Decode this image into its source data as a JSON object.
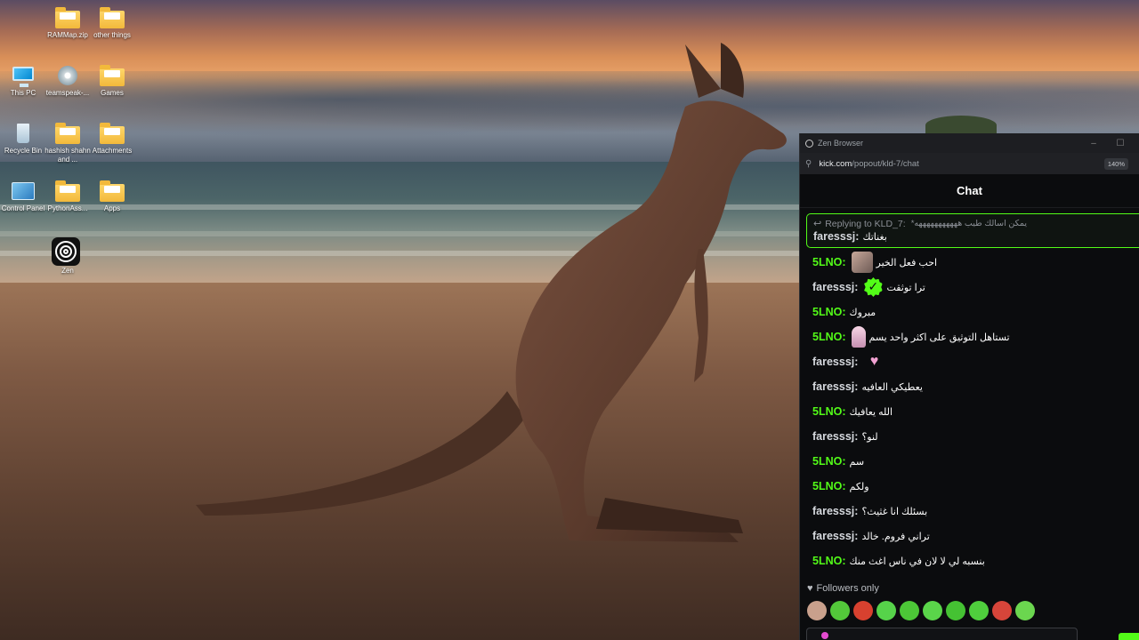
{
  "desktop": {
    "icons": [
      {
        "label": "RAMMap.zip",
        "icon": "zip-folder-icon"
      },
      {
        "label": "other things",
        "icon": "folder-icon"
      },
      {
        "label": "This PC",
        "icon": "monitor-icon"
      },
      {
        "label": "teamspeak-...",
        "icon": "disc-installer-icon"
      },
      {
        "label": "Games",
        "icon": "folder-icon"
      },
      {
        "label": "Recycle Bin",
        "icon": "recycle-bin-icon"
      },
      {
        "label": "hashish shahn and ...",
        "icon": "folder-icon"
      },
      {
        "label": "Attachments",
        "icon": "folder-icon"
      },
      {
        "label": "Control Panel",
        "icon": "control-panel-icon"
      },
      {
        "label": "PythonAss...",
        "icon": "folder-icon"
      },
      {
        "label": "Apps",
        "icon": "folder-icon"
      },
      {
        "label": "Zen",
        "icon": "zen-browser-icon"
      }
    ]
  },
  "browser": {
    "title": "Zen Browser",
    "url_domain": "kick.com",
    "url_path": "/popout/kld-7/chat",
    "zoom": "140%",
    "controls": {
      "minimize": "–",
      "maximize": "☐"
    }
  },
  "chat": {
    "header": "Chat",
    "reply": {
      "prefix": "Replying to KLD_7:",
      "quoted": "يمكن اسالك طيب هههههههههههه*",
      "user": "faresssj:",
      "text": "بغناتك"
    },
    "messages": [
      {
        "user": "5LNO:",
        "color": "green",
        "emote": "cat",
        "text": "احب فعل الخير"
      },
      {
        "user": "faresssj:",
        "color": "grey",
        "emote": "verified-check",
        "text": "ترا توثقت"
      },
      {
        "user": "5LNO:",
        "color": "green",
        "emote": "",
        "text": "مبروك"
      },
      {
        "user": "5LNO:",
        "color": "green",
        "emote": "girl",
        "text": "تستاهل التوثيق على اكثر واحد يسم"
      },
      {
        "user": "faresssj:",
        "color": "grey",
        "emote": "heart",
        "text": ""
      },
      {
        "user": "faresssj:",
        "color": "grey",
        "emote": "",
        "text": "يعطيكي العافيه"
      },
      {
        "user": "5LNO:",
        "color": "green",
        "emote": "",
        "text": "الله يعافيك"
      },
      {
        "user": "faresssj:",
        "color": "grey",
        "emote": "",
        "text": "لنو؟"
      },
      {
        "user": "5LNO:",
        "color": "green",
        "emote": "",
        "text": "سم"
      },
      {
        "user": "5LNO:",
        "color": "green",
        "emote": "",
        "text": "ولكم"
      },
      {
        "user": "faresssj:",
        "color": "grey",
        "emote": "",
        "text": "بسئلك انا غثيث؟"
      },
      {
        "user": "faresssj:",
        "color": "grey",
        "emote": "",
        "text": "تراني فروم. خالد"
      },
      {
        "user": "5LNO:",
        "color": "green",
        "emote": "",
        "text": "بنسبه لي لا لان في ناس اغث منك"
      }
    ],
    "followers_only": "Followers only",
    "emote_bar": [
      "#c9a08c",
      "#53c83a",
      "#d8412f",
      "#56d34a",
      "#4cc737",
      "#5ad54a",
      "#45c233",
      "#4fcf3d",
      "#d6453a",
      "#6bd64f"
    ],
    "colors": {
      "accent": "#53fc18",
      "username_grey": "#d6d9de",
      "background": "#0b0c0e"
    }
  }
}
